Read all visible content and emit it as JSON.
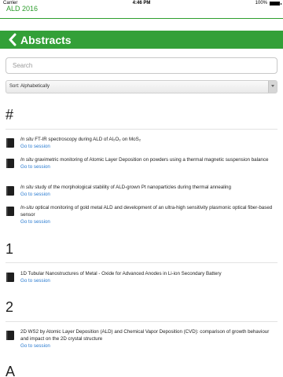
{
  "status_bar": {
    "carrier": "Carrier",
    "time": "4:46 PM",
    "battery": "100%",
    "battery_level": 1.0
  },
  "app": {
    "title": "ALD 2016"
  },
  "header": {
    "title": "Abstracts"
  },
  "search": {
    "placeholder": "Search",
    "value": ""
  },
  "sort": {
    "label": "Sort: Alphabetically"
  },
  "sections": {
    "hash": {
      "letter": "#",
      "items": [
        {
          "pre": "In situ",
          "title": " FT-IR spectroscopy during ALD of Al₂O₃ on MoS₂",
          "link": "Go to session"
        },
        {
          "pre": "In situ",
          "title": " gravimetric monitoring of Atomic Layer Deposition on powders using a thermal magnetic suspension balance",
          "link": "Go to session"
        },
        {
          "pre": "In situ",
          "title": " study of the morphological stability of ALD-grown Pt nanoparticles during thermal annealing",
          "link": "Go to session"
        },
        {
          "pre": "In-situ",
          "title": " optical monitoring of gold metal ALD and development of an ultra-high sensitivity plasmonic optical fiber-based sensor",
          "link": "Go to session"
        }
      ]
    },
    "one": {
      "letter": "1",
      "items": [
        {
          "pre": "",
          "title": "1D Tubular Nanostructures of Metal - Oxide for Advanced Anodes in Li-ion Secondary Battery",
          "link": "Go to session"
        }
      ]
    },
    "two": {
      "letter": "2",
      "items": [
        {
          "pre": "",
          "title": "2D WS2 by Atomic Layer Deposition (ALD) and Chemical Vapor Deposition (CVD): comparison of growth behaviour and impact on the 2D crystal structure",
          "link": "Go to session"
        }
      ]
    },
    "a": {
      "letter": "A"
    }
  },
  "colors": {
    "brand_green": "#33a038",
    "link_blue": "#2a7bd0"
  }
}
